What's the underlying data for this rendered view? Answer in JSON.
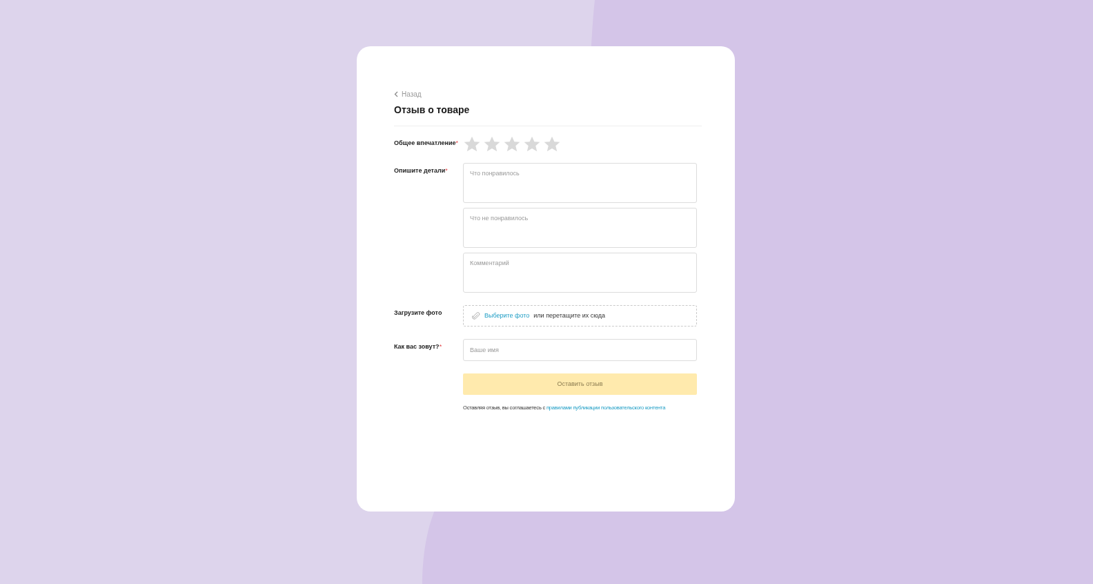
{
  "back_link": "Назад",
  "title": "Отзыв о товаре",
  "rating": {
    "label": "Общее впечатление",
    "required_mark": "*",
    "stars": 0
  },
  "details": {
    "label": "Опишите детали",
    "required_mark": "*",
    "fields": [
      {
        "placeholder": "Что понравилось"
      },
      {
        "placeholder": "Что не понравилось"
      },
      {
        "placeholder": "Комментарий"
      }
    ]
  },
  "photo": {
    "label": "Загрузите фото",
    "link": "Выберите фото",
    "text": "или перетащите их сюда"
  },
  "name": {
    "label": "Как вас зовут?",
    "required_mark": "*",
    "placeholder": "Ваше имя"
  },
  "submit": {
    "label": "Оставить отзыв",
    "disabled": true
  },
  "agreement": {
    "text": "Оставляя отзыв, вы соглашаетесь с",
    "link": "правилами публикации пользовательского контента"
  }
}
